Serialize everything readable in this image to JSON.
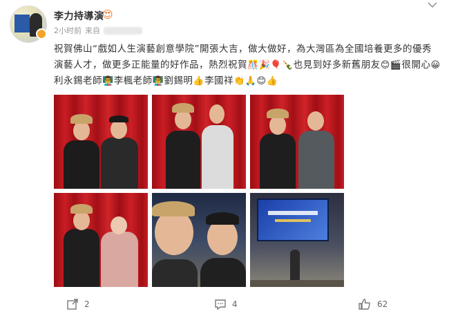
{
  "post": {
    "author": "李力持導演",
    "time": "2小时前",
    "source_prefix": "来自",
    "text": {
      "p1": "祝賀佛山“戲如人生演藝創意學院”開張大吉，做大做好，為大灣區為全國培養更多的優秀演藝人才，做更多正能量的好作品，熱烈祝賀",
      "p2": "也見到好多新舊朋友",
      "p3": "很開心",
      "n1": "利永錫老師",
      "n2": "李楓老師",
      "n3": "劉錫明",
      "n4": "李國祥"
    },
    "emojis": {
      "cheer": "🎊",
      "party": "🎉",
      "balloon": "🎈",
      "bottle": "🍾",
      "smile": "😊",
      "clapper": "🎬",
      "grin": "😀",
      "teacher": "👨‍🏫",
      "thumbs": "👍",
      "clap": "👏",
      "pray": "🙏",
      "smile2": "😊",
      "fan": "😍"
    }
  },
  "photos": {
    "screen_banner": "戲如人生演藝創意學院"
  },
  "actions": {
    "repost_count": "2",
    "comment_count": "4",
    "like_count": "62"
  },
  "colors": {
    "accent_orange": "#f07a2b",
    "curtain_red": "#c91d24",
    "vip_gold": "#f3a42b"
  }
}
